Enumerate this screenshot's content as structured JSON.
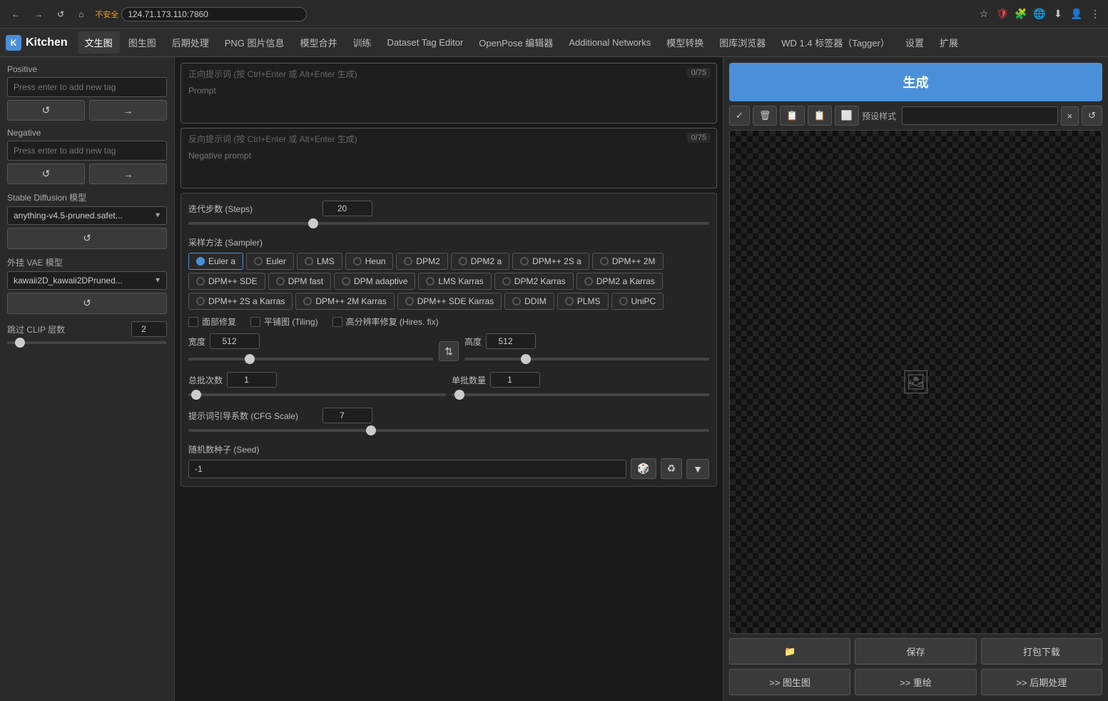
{
  "browser": {
    "back_btn": "←",
    "forward_btn": "→",
    "refresh_btn": "↺",
    "home_btn": "⌂",
    "security_warning": "不安全",
    "address": "124.71.173.110:7860",
    "menu_btn": "⋮"
  },
  "nav": {
    "logo_text": "Kitchen",
    "tabs": [
      {
        "label": "文生图",
        "active": true
      },
      {
        "label": "图生图"
      },
      {
        "label": "后期处理"
      },
      {
        "label": "PNG 图片信息"
      },
      {
        "label": "模型合并"
      },
      {
        "label": "训练"
      },
      {
        "label": "Dataset Tag Editor"
      },
      {
        "label": "OpenPose 编辑器"
      },
      {
        "label": "Additional Networks"
      },
      {
        "label": "模型转换"
      },
      {
        "label": "图库浏览器"
      },
      {
        "label": "WD 1.4 标签器（Tagger）"
      },
      {
        "label": "设置"
      },
      {
        "label": "扩展"
      }
    ]
  },
  "sidebar": {
    "positive_label": "Positive",
    "positive_placeholder": "Press enter to add new tag",
    "negative_label": "Negative",
    "negative_placeholder": "Press enter to add new tag",
    "btn1_icon": "↺",
    "btn2_icon": "→",
    "model_label": "Stable Diffusion 模型",
    "model_value": "anything-v4.5-pruned.safet...",
    "vae_label": "外挂 VAE 模型",
    "vae_value": "kawaii2D_kawaii2DPruned...",
    "clip_label": "跳过 CLIP 层数",
    "clip_value": "2",
    "clip_slider_pct": 8
  },
  "prompt": {
    "positive_hint": "正向提示词 (按 Ctrl+Enter 或 Alt+Enter 生成)",
    "positive_placeholder_text": "Prompt",
    "positive_counter": "0/75",
    "negative_hint": "反向提示词 (按 Ctrl+Enter 或 Alt+Enter 生成)",
    "negative_placeholder_text": "Negative prompt",
    "negative_counter": "0/75"
  },
  "controls": {
    "steps_label": "迭代步数 (Steps)",
    "steps_value": "20",
    "steps_slider_pct": 24,
    "sampler_label": "采样方法 (Sampler)",
    "samplers": [
      {
        "label": "Euler a",
        "active": true
      },
      {
        "label": "Euler",
        "active": false
      },
      {
        "label": "LMS",
        "active": false
      },
      {
        "label": "Heun",
        "active": false
      },
      {
        "label": "DPM2",
        "active": false
      },
      {
        "label": "DPM2 a",
        "active": false
      },
      {
        "label": "DPM++ 2S a",
        "active": false
      },
      {
        "label": "DPM++ 2M",
        "active": false
      },
      {
        "label": "DPM++ SDE",
        "active": false
      },
      {
        "label": "DPM fast",
        "active": false
      },
      {
        "label": "DPM adaptive",
        "active": false
      },
      {
        "label": "LMS Karras",
        "active": false
      },
      {
        "label": "DPM2 Karras",
        "active": false
      },
      {
        "label": "DPM2 a Karras",
        "active": false
      },
      {
        "label": "DPM++ 2S a Karras",
        "active": false
      },
      {
        "label": "DPM++ 2M Karras",
        "active": false
      },
      {
        "label": "DPM++ SDE Karras",
        "active": false
      },
      {
        "label": "DDIM",
        "active": false
      },
      {
        "label": "PLMS",
        "active": false
      },
      {
        "label": "UniPC",
        "active": false
      }
    ],
    "face_fix_label": "面部修复",
    "tiling_label": "平铺图 (Tiling)",
    "hires_label": "高分辨率修复 (Hires. fix)",
    "width_label": "宽度",
    "width_value": "512",
    "width_slider_pct": 25,
    "height_label": "高度",
    "height_value": "512",
    "height_slider_pct": 25,
    "swap_icon": "⇅",
    "batch_count_label": "总批次数",
    "batch_count_value": "1",
    "batch_size_label": "单批数量",
    "batch_size_value": "1",
    "cfg_label": "提示词引导系数 (CFG Scale)",
    "cfg_value": "7",
    "cfg_slider_pct": 35,
    "seed_label": "随机数种子 (Seed)",
    "seed_value": "-1",
    "seed_dice_icon": "🎲",
    "seed_recycle_icon": "♻",
    "seed_extra_icon": "▼"
  },
  "right_panel": {
    "generate_label": "生成",
    "toolbar_btns": [
      "✓",
      "🗑",
      "📋",
      "📋",
      "⬜"
    ],
    "preset_label": "预设样式",
    "preset_placeholder": "",
    "preset_clear_icon": "×",
    "preset_apply_icon": "↺",
    "action_folder": "📁",
    "action_save": "保存",
    "action_download": "打包下载",
    "action_to_img2img": ">> 图生图",
    "action_repaint": ">> 重绘",
    "action_postprocess": ">> 后期处理"
  }
}
